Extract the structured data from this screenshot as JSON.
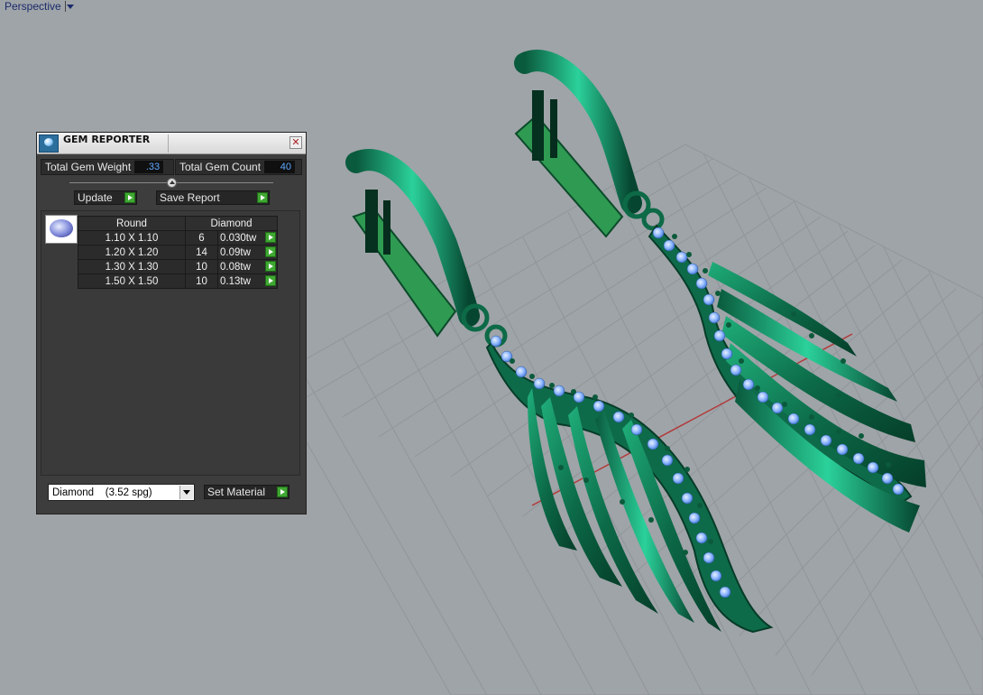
{
  "viewport": {
    "label": "Perspective"
  },
  "panel": {
    "title": "GEM REPORTER",
    "total_weight_label": "Total Gem Weight",
    "total_weight_value": ".33",
    "total_count_label": "Total Gem Count",
    "total_count_value": "40",
    "update_label": "Update",
    "save_label": "Save Report",
    "table": {
      "headers": [
        "Round",
        "Diamond"
      ],
      "rows": [
        {
          "size": "1.10 X 1.10",
          "count": "6",
          "weight": "0.030tw"
        },
        {
          "size": "1.20 X 1.20",
          "count": "14",
          "weight": "0.09tw"
        },
        {
          "size": "1.30 X 1.30",
          "count": "10",
          "weight": "0.08tw"
        },
        {
          "size": "1.50 X 1.50",
          "count": "10",
          "weight": "0.13tw"
        }
      ]
    },
    "material_select": "Diamond    (3.52 spg)",
    "set_material_label": "Set Material"
  },
  "colors": {
    "viewport_bg": "#9fa4a8",
    "metal_green": "#0e6b4a",
    "gem_blue": "#8fb8ff",
    "accent_green_button": "#3fa832"
  }
}
